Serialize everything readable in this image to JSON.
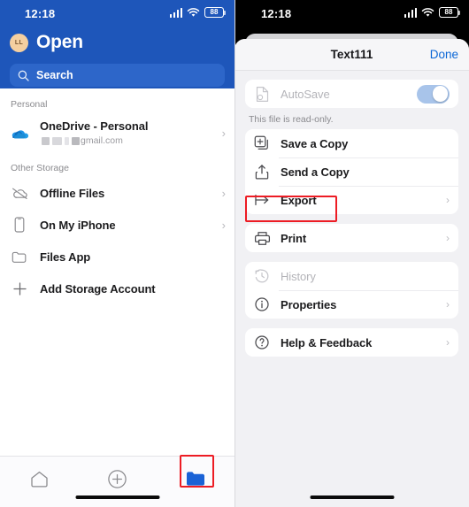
{
  "left_panel": {
    "status_bar": {
      "time": "12:18",
      "battery": "88",
      "signal_icon": "cellular-bars-icon",
      "wifi_icon": "wifi-icon"
    },
    "header": {
      "avatar_initials": "LL",
      "avatar_name": "avatar",
      "title": "Open",
      "accent_color": "#1e56ba"
    },
    "search": {
      "placeholder": "Search",
      "icon": "search-icon"
    },
    "sections": [
      {
        "label": "Personal",
        "items": [
          {
            "label": "OneDrive - Personal",
            "icon": "onedrive-cloud-icon",
            "subtitle_domain": "gmail.com",
            "subtitle_redacted": true,
            "chevron": "›"
          }
        ]
      },
      {
        "label": "Other Storage",
        "items": [
          {
            "label": "Offline Files",
            "icon": "cloud-slash-icon",
            "chevron": "›"
          },
          {
            "label": "On My iPhone",
            "icon": "iphone-icon",
            "chevron": "›"
          },
          {
            "label": "Files App",
            "icon": "folder-outline-icon",
            "chevron": ""
          },
          {
            "label": "Add Storage Account",
            "icon": "plus-icon",
            "chevron": ""
          }
        ]
      }
    ],
    "tab_bar": [
      {
        "name": "home-icon",
        "label": "Home",
        "active": false
      },
      {
        "name": "plus-circle-icon",
        "label": "New",
        "active": false
      },
      {
        "name": "folder-icon",
        "label": "Open",
        "active": true,
        "color": "#1a62d6"
      }
    ]
  },
  "right_panel": {
    "status_bar": {
      "time": "12:18",
      "battery": "88",
      "signal_icon": "cellular-bars-icon",
      "wifi_icon": "wifi-icon"
    },
    "sheet": {
      "title": "Text111",
      "done_label": "Done",
      "done_color": "#0a66d6",
      "groups": [
        {
          "rows": [
            {
              "label": "AutoSave",
              "icon": "autosave-document-icon",
              "disabled": true,
              "control": "toggle",
              "toggle_on": true,
              "toggle_color": "#a8c4ea"
            }
          ],
          "footnote": "This file is read-only."
        },
        {
          "rows": [
            {
              "label": "Save a Copy",
              "icon": "save-copy-icon",
              "disabled": false,
              "chevron": ""
            },
            {
              "label": "Send a Copy",
              "icon": "send-copy-icon",
              "disabled": false,
              "chevron": ""
            },
            {
              "label": "Export",
              "icon": "export-arrow-icon",
              "disabled": false,
              "chevron": "›",
              "highlighted": true
            }
          ]
        },
        {
          "rows": [
            {
              "label": "Print",
              "icon": "printer-icon",
              "disabled": false,
              "chevron": "›"
            }
          ]
        },
        {
          "rows": [
            {
              "label": "History",
              "icon": "clock-history-icon",
              "disabled": true,
              "chevron": ""
            },
            {
              "label": "Properties",
              "icon": "info-circle-icon",
              "disabled": false,
              "chevron": "›"
            }
          ]
        },
        {
          "rows": [
            {
              "label": "Help & Feedback",
              "icon": "question-circle-icon",
              "disabled": false,
              "chevron": "›"
            }
          ]
        }
      ]
    }
  },
  "annotations": [
    {
      "name": "export-row-highlight",
      "color": "#ed1c24"
    },
    {
      "name": "open-tab-highlight",
      "color": "#ed1c24"
    }
  ]
}
